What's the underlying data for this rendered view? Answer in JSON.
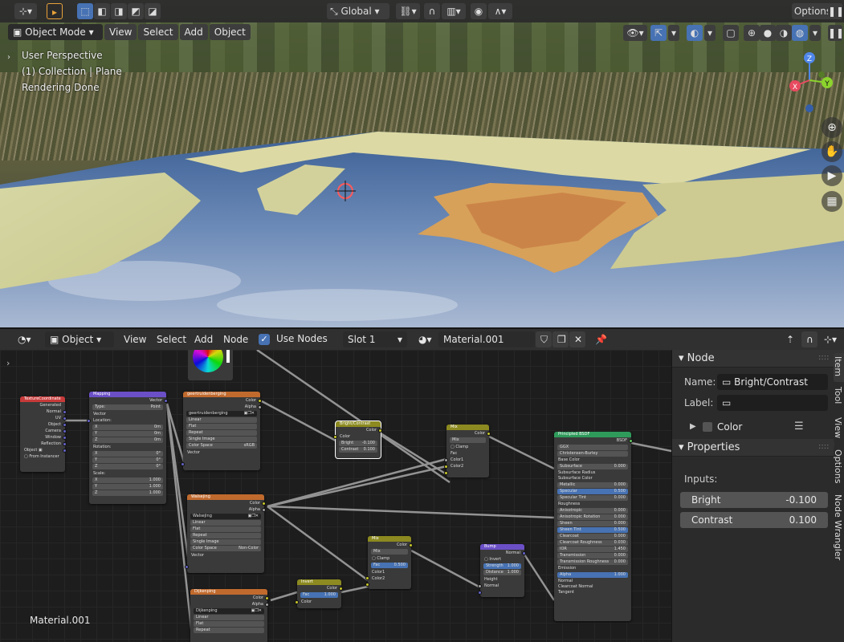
{
  "viewport": {
    "mode": "Object Mode",
    "menu": [
      "View",
      "Select",
      "Add",
      "Object"
    ],
    "transform_orientation": "Global",
    "options_label": "Options",
    "overlay_lines": [
      "User Perspective",
      "(1) Collection | Plane",
      "Rendering Done"
    ],
    "gizmo_axes": {
      "z": "Z",
      "y": "Y",
      "x": "X"
    }
  },
  "node_editor": {
    "editor_type": "Object",
    "menu": [
      "View",
      "Select",
      "Add",
      "Node"
    ],
    "use_nodes_label": "Use Nodes",
    "use_nodes_checked": true,
    "slot": "Slot 1",
    "material_name": "Material.001",
    "material_label": "Material.001",
    "nodes": {
      "texcoord": {
        "title": "TextureCoordinate",
        "outputs": [
          "Generated",
          "Normal",
          "UV",
          "Object",
          "Camera",
          "Window",
          "Reflection"
        ],
        "object_label": "Object",
        "from_instancer": "From Instancer"
      },
      "mapping": {
        "title": "Mapping",
        "out": "Vector",
        "type_label": "Type:",
        "type_value": "Point",
        "vector": "Vector",
        "location": "Location:",
        "rotation": "Rotation:",
        "scale": "Scale:",
        "loc": [
          [
            "X",
            "0m"
          ],
          [
            "Y",
            "0m"
          ],
          [
            "Z",
            "0m"
          ]
        ],
        "rot": [
          [
            "X",
            "0°"
          ],
          [
            "Y",
            "0°"
          ],
          [
            "Z",
            "0°"
          ]
        ],
        "scl": [
          [
            "X",
            "1.000"
          ],
          [
            "Y",
            "1.000"
          ],
          [
            "Z",
            "1.000"
          ]
        ]
      },
      "img1": {
        "title": "geertruidenberging",
        "color": "Color",
        "alpha": "Alpha",
        "image_name": "geertruidenberging",
        "opts": [
          "Linear",
          "Flat",
          "Repeat",
          "Single Image"
        ],
        "colorspace_label": "Color Space",
        "colorspace": "sRGB",
        "vector": "Vector"
      },
      "img2": {
        "title": "Walsejing",
        "color": "Color",
        "alpha": "Alpha",
        "image_name": "Walsejing",
        "opts": [
          "Linear",
          "Flat",
          "Repeat",
          "Single Image"
        ],
        "colorspace_label": "Color Space",
        "colorspace": "Non-Color",
        "vector": "Vector"
      },
      "img3": {
        "title": "Dijkenping",
        "color": "Color",
        "alpha": "Alpha",
        "image_name": "Dijkenping",
        "opts": [
          "Linear",
          "Flat",
          "Repeat"
        ]
      },
      "brightcontrast": {
        "title": "Bright/Contrast",
        "out": "Color",
        "inputs": [
          "Color"
        ],
        "bright_label": "Bright",
        "bright": "-0.100",
        "contrast_label": "Contrast",
        "contrast": "0.100"
      },
      "mix1": {
        "title": "Mix",
        "out": "Color",
        "blend": "Mix",
        "clamp": "Clamp",
        "inputs": [
          "Fac",
          "Color1",
          "Color2"
        ]
      },
      "mix2": {
        "title": "Mix",
        "out": "Color",
        "blend": "Mix",
        "clamp": "Clamp",
        "fac_label": "Fac",
        "fac": "0.500",
        "inputs": [
          "Color1",
          "Color2"
        ]
      },
      "invert": {
        "title": "Invert",
        "out": "Color",
        "fac_label": "Fac",
        "fac": "1.000",
        "color": "Color"
      },
      "bump": {
        "title": "Bump",
        "out": "Normal",
        "invert": "Invert",
        "strength_label": "Strength",
        "strength": "1.000",
        "distance_label": "Distance",
        "distance": "1.000",
        "inputs": [
          "Height",
          "Normal"
        ]
      },
      "principled": {
        "title": "Principled BSDF",
        "out": "BSDF",
        "dist": "GGX",
        "sss": "Christensen-Burley",
        "rows": [
          [
            "Base Color",
            ""
          ],
          [
            "Subsurface",
            "0.000"
          ],
          [
            "Subsurface Radius",
            ""
          ],
          [
            "Subsurface Color",
            ""
          ],
          [
            "Metallic",
            "0.000"
          ],
          [
            "Specular",
            "0.500"
          ],
          [
            "Specular Tint",
            "0.000"
          ],
          [
            "Roughness",
            ""
          ],
          [
            "Anisotropic",
            "0.000"
          ],
          [
            "Anisotropic Rotation",
            "0.000"
          ],
          [
            "Sheen",
            "0.000"
          ],
          [
            "Sheen Tint",
            "0.500"
          ],
          [
            "Clearcoat",
            "0.000"
          ],
          [
            "Clearcoat Roughness",
            "0.030"
          ],
          [
            "IOR",
            "1.450"
          ],
          [
            "Transmission",
            "0.000"
          ],
          [
            "Transmission Roughness",
            "0.000"
          ],
          [
            "Emission",
            ""
          ],
          [
            "Alpha",
            "1.000"
          ],
          [
            "Normal",
            ""
          ],
          [
            "Clearcoat Normal",
            ""
          ],
          [
            "Tangent",
            ""
          ]
        ]
      }
    }
  },
  "sidebar": {
    "node_panel": "Node",
    "name_label": "Name:",
    "name_value": "Bright/Contrast",
    "label_label": "Label:",
    "label_value": "",
    "color_label": "Color",
    "properties_panel": "Properties",
    "inputs_label": "Inputs:",
    "bright_label": "Bright",
    "bright_value": "-0.100",
    "contrast_label": "Contrast",
    "contrast_value": "0.100",
    "tabs": [
      "Item",
      "Tool",
      "View",
      "Options",
      "Node Wrangler"
    ]
  },
  "colors": {
    "accent": "#4772b3",
    "header_bg": "#303030",
    "texture_node": "#c06a2e",
    "converter_node": "#3a6f7d",
    "shader_node": "#2f9b5b",
    "color_node": "#8c8a20",
    "vector_node": "#6b4fc7",
    "input_node": "#c73a3a"
  }
}
